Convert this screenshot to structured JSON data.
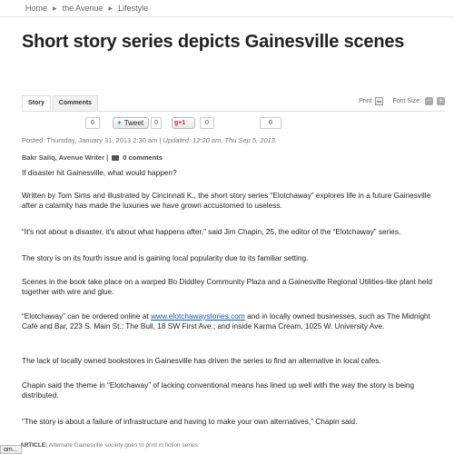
{
  "breadcrumb": [
    "Home",
    "the Avenue",
    "Lifestyle"
  ],
  "headline": "Short story series depicts Gainesville scenes",
  "tabs": {
    "story": "Story",
    "comments": "Comments"
  },
  "tools": {
    "print": "Print",
    "font_size": "Font Size:",
    "decrease": "−",
    "increase": "+"
  },
  "social": {
    "count_1": "0",
    "tweet": "Tweet",
    "tweet_count": "0",
    "gplus": "+1",
    "gplus_count": "0",
    "count_4": "0"
  },
  "posted": "Posted: Thursday, January 31, 2013 2:30 am |",
  "updated": "Updated: 12:20 am, Thu Sep 5, 2013.",
  "author": "Bakr Saliq, Avenue Writer |",
  "comments_count": "0 comments",
  "paragraphs": [
    "If disaster hit Gainesville, what would happen?",
    "Written by Tom Sims and illustrated by Cincinnati K., the short story series “Elotchaway” explores life in a future Gainesville after a calamity has made the luxuries we have grown accustomed to useless.",
    "“It's not about a disaster, it's about what happens after,” said Jim Chapin, 25, the editor of the “Elotchaway” series.",
    "The story is on its fourth issue and is gaining local popularity due to its familiar setting.",
    "Scenes in the book take place on a warped Bo Diddley Community Plaza and a Gainesville Regional Utilities-like plant held together with wire and glue.",
    "The lack of locally owned bookstores in Gainesville has driven the series to find an alternative in local cafes.",
    "Chapin said the theme in “Elotchaway” of lacking conventional means has lined up well with the way the story is being distributed.",
    "“The story is about a failure of infrastructure and having to make your own alternatives,” Chapin said."
  ],
  "order_para": {
    "before": "“Elotchaway” can be ordered online at ",
    "link": "www.elotchawaystories.com",
    "after": " and in locally owned businesses, such as The Midnight Café and Bar, 223 S. Main St.; The Bull, 18 SW First Ave.; and inside Karma Cream, 1025 W. University Ave."
  },
  "footer": {
    "label": "ARTICLE:",
    "text": "Alternate Gainesville society goes to print in fiction series"
  },
  "status_tip": "om..."
}
